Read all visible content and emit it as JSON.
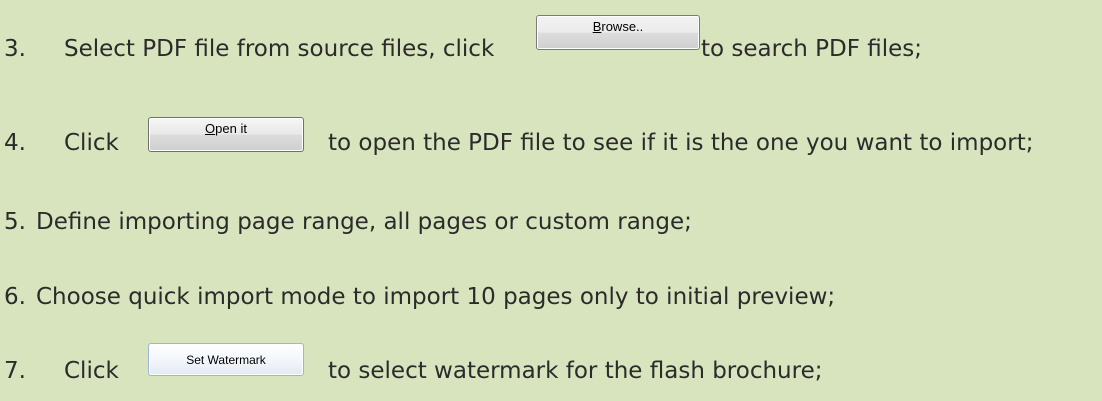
{
  "steps": [
    {
      "number": "3.",
      "before": "Select PDF file from source files, click",
      "button": {
        "mnemonic": "B",
        "rest": "rowse.."
      },
      "after": "to search PDF files;"
    },
    {
      "number": "4.",
      "before": "Click",
      "button": {
        "mnemonic": "O",
        "rest": "pen it"
      },
      "after": "to open the PDF file to see if it is the one you want to import;"
    },
    {
      "number": "5.",
      "text": "Define importing page range, all pages or custom range;"
    },
    {
      "number": "6.",
      "text": "Choose quick import mode to import 10 pages only to initial preview;"
    },
    {
      "number": "7.",
      "before": "Click",
      "button": {
        "label": "Set Watermark"
      },
      "after": "to select watermark for the flash brochure;"
    }
  ]
}
